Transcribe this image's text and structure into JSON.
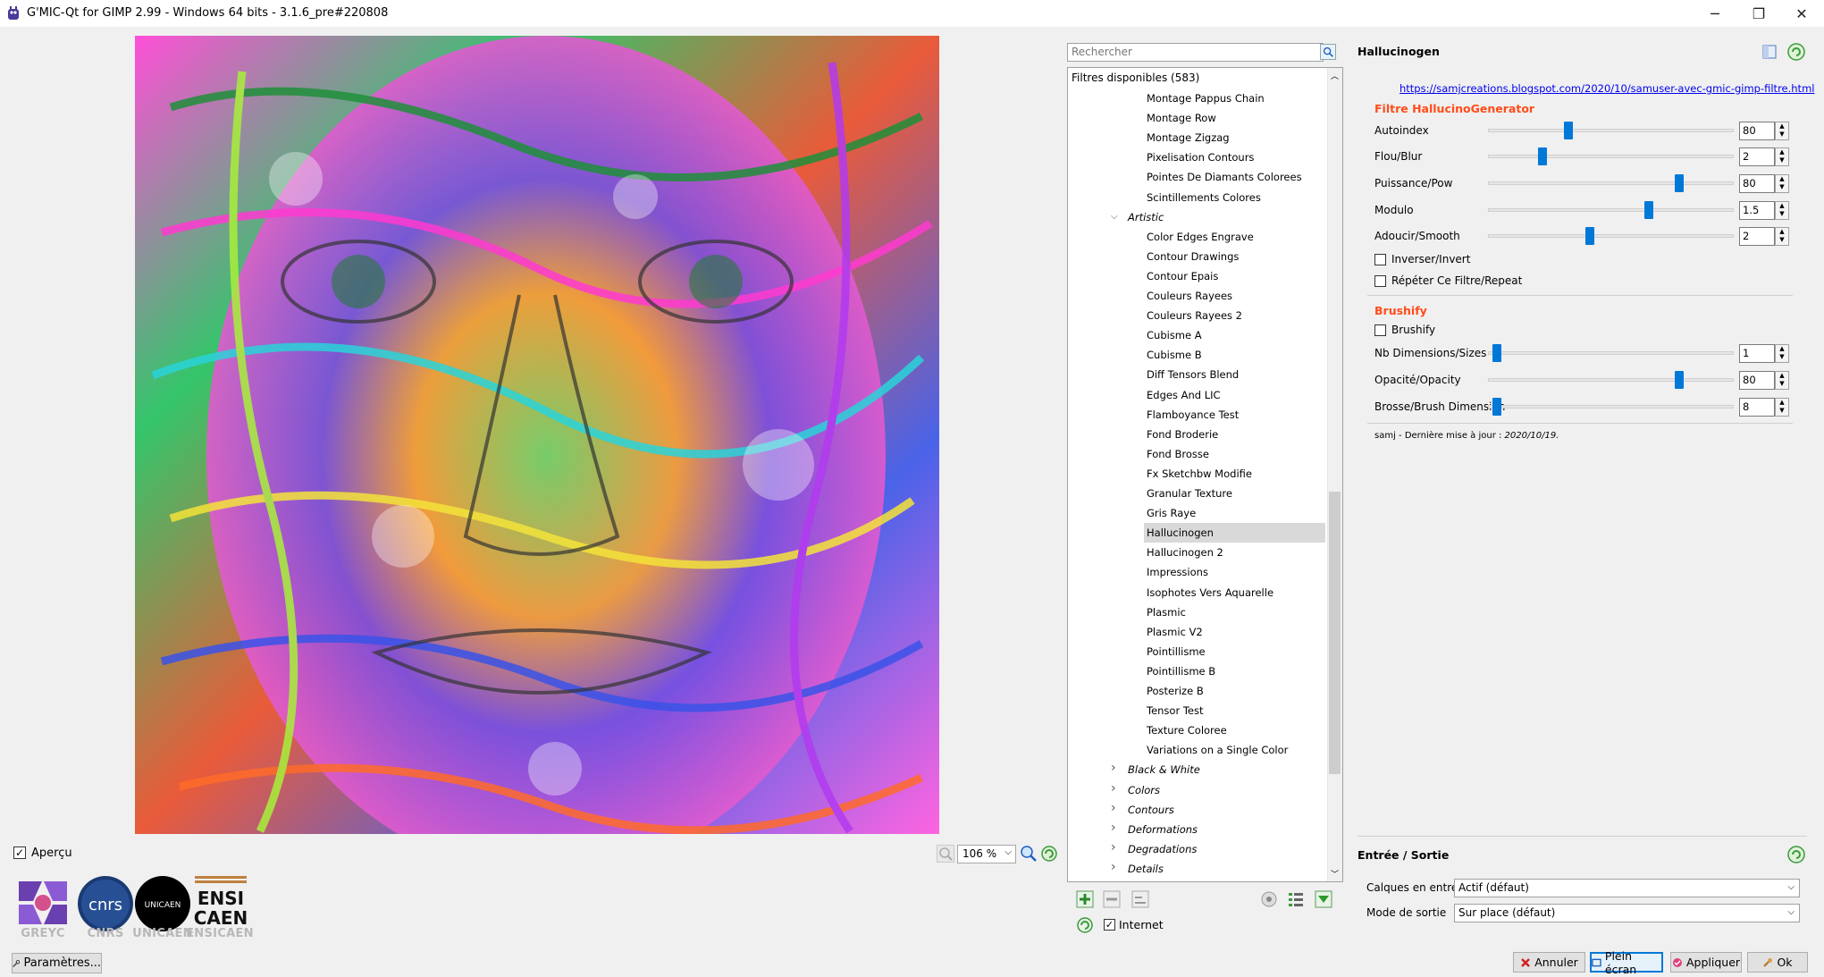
{
  "window": {
    "title": "G'MIC-Qt for GIMP 2.99 - Windows 64 bits - 3.1.6_pre#220808",
    "minimize": "─",
    "restore": "❐",
    "close": "✕"
  },
  "preview": {
    "apercu_label": "Aperçu",
    "apercu_checked": "✓",
    "zoom_value": "106 %"
  },
  "logos": [
    "GREYC",
    "CNRS",
    "UNICAEN",
    "ENSICAEN"
  ],
  "logo_text": {
    "cnrs": "cnrs",
    "unicaen": "UNICAEN",
    "ensicaen_line1": "ENSI",
    "ensicaen_line2": "CAEN"
  },
  "params_button": "Paramètres...",
  "search": {
    "placeholder": "Rechercher"
  },
  "tree": {
    "header": "Filtres disponibles (583)",
    "items": [
      {
        "label": "Montage Pappus Chain",
        "level": 2
      },
      {
        "label": "Montage Row",
        "level": 2
      },
      {
        "label": "Montage Zigzag",
        "level": 2
      },
      {
        "label": "Pixelisation Contours",
        "level": 2
      },
      {
        "label": "Pointes De Diamants Colorees",
        "level": 2
      },
      {
        "label": "Scintillements Colores",
        "level": 2
      },
      {
        "label": "Artistic",
        "level": 1,
        "folder": true,
        "expanded": true
      },
      {
        "label": "Color Edges Engrave",
        "level": 2
      },
      {
        "label": "Contour Drawings",
        "level": 2
      },
      {
        "label": "Contour Epais",
        "level": 2
      },
      {
        "label": "Couleurs Rayees",
        "level": 2
      },
      {
        "label": "Couleurs Rayees 2",
        "level": 2
      },
      {
        "label": "Cubisme A",
        "level": 2
      },
      {
        "label": "Cubisme B",
        "level": 2
      },
      {
        "label": "Diff Tensors Blend",
        "level": 2
      },
      {
        "label": "Edges And LIC",
        "level": 2
      },
      {
        "label": "Flamboyance Test",
        "level": 2
      },
      {
        "label": "Fond Broderie",
        "level": 2
      },
      {
        "label": "Fond Brosse",
        "level": 2
      },
      {
        "label": "Fx Sketchbw Modifie",
        "level": 2
      },
      {
        "label": "Granular Texture",
        "level": 2
      },
      {
        "label": "Gris Raye",
        "level": 2
      },
      {
        "label": "Hallucinogen",
        "level": 2,
        "selected": true
      },
      {
        "label": "Hallucinogen 2",
        "level": 2
      },
      {
        "label": "Impressions",
        "level": 2
      },
      {
        "label": "Isophotes Vers Aquarelle",
        "level": 2
      },
      {
        "label": "Plasmic",
        "level": 2
      },
      {
        "label": "Plasmic V2",
        "level": 2
      },
      {
        "label": "Pointillisme",
        "level": 2
      },
      {
        "label": "Pointillisme B",
        "level": 2
      },
      {
        "label": "Posterize B",
        "level": 2
      },
      {
        "label": "Tensor Test",
        "level": 2
      },
      {
        "label": "Texture Coloree",
        "level": 2
      },
      {
        "label": "Variations on a Single Color",
        "level": 2
      },
      {
        "label": "Black & White",
        "level": 1,
        "folder": true
      },
      {
        "label": "Colors",
        "level": 1,
        "folder": true
      },
      {
        "label": "Contours",
        "level": 1,
        "folder": true
      },
      {
        "label": "Deformations",
        "level": 1,
        "folder": true
      },
      {
        "label": "Degradations",
        "level": 1,
        "folder": true
      },
      {
        "label": "Details",
        "level": 1,
        "folder": true
      }
    ],
    "internet_label": "Internet",
    "internet_checked": "✓"
  },
  "filter": {
    "title": "Hallucinogen",
    "link": "https://samjcreations.blogspot.com/2020/10/samuser-avec-gmic-gimp-filtre.html",
    "section1": "Filtre HallucinoGenerator",
    "params1": [
      {
        "label": "Autoindex",
        "value": "80",
        "fraction": 0.32
      },
      {
        "label": "Flou/Blur",
        "value": "2",
        "fraction": 0.21
      },
      {
        "label": "Puissance/Pow",
        "value": "80",
        "fraction": 0.79
      },
      {
        "label": "Modulo",
        "value": "1.5",
        "fraction": 0.66
      },
      {
        "label": "Adoucir/Smooth",
        "value": "2",
        "fraction": 0.41
      }
    ],
    "checks1": [
      {
        "label": "Inverser/Invert",
        "checked": false
      },
      {
        "label": "Répéter Ce Filtre/Repeat",
        "checked": false
      }
    ],
    "section2": "Brushify",
    "check2": {
      "label": "Brushify",
      "checked": false
    },
    "params2": [
      {
        "label": "Nb Dimensions/Sizes",
        "value": "1",
        "fraction": 0.02
      },
      {
        "label": "Opacité/Opacity",
        "value": "80",
        "fraction": 0.79
      },
      {
        "label": "Brosse/Brush Dimension",
        "value": "8",
        "fraction": 0.02
      }
    ],
    "footer_prefix": "samj - Dernière mise à jour : ",
    "footer_date": "2020/10/19."
  },
  "io": {
    "title": "Entrée / Sortie",
    "input_label": "Calques en entrée",
    "input_value": "Actif (défaut)",
    "output_label": "Mode de sortie",
    "output_value": "Sur place (défaut)"
  },
  "buttons": {
    "cancel": "Annuler",
    "fullscreen": "Plein écran",
    "apply": "Appliquer",
    "ok": "Ok"
  },
  "colors": {
    "accent": "#0078d7",
    "section": "#ff4d1a",
    "link": "#0000ee"
  }
}
